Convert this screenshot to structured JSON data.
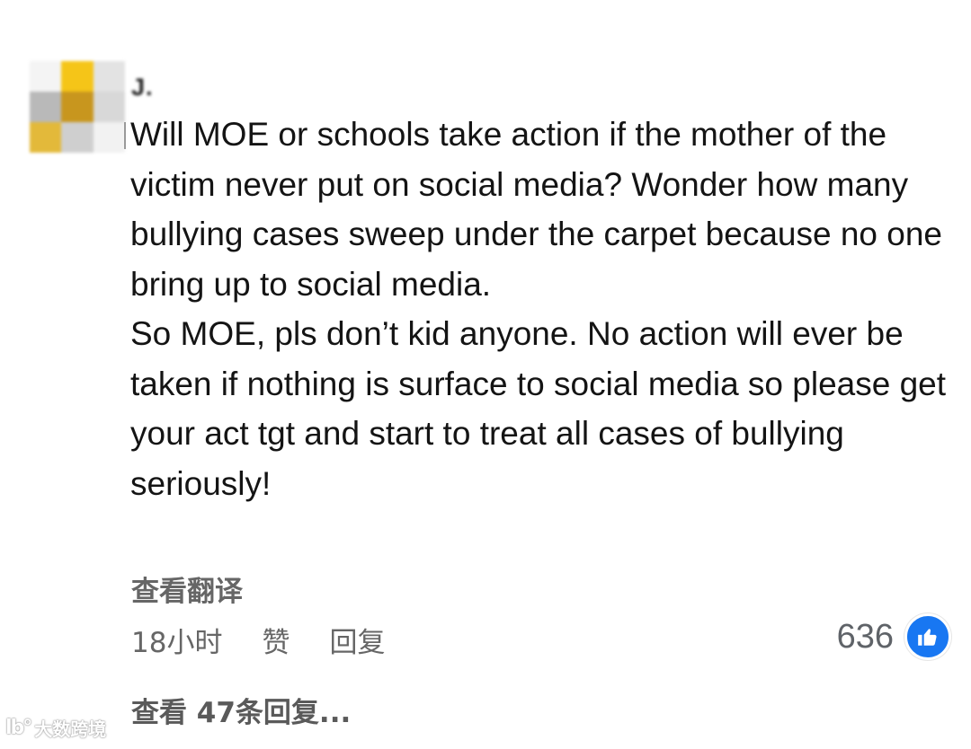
{
  "comment": {
    "author_name": "J.",
    "body_paragraphs": [
      "Will MOE or schools take action if the mother of the victim never put on social media? Wonder how many bullying cases sweep under the carpet because no one bring up to social media.",
      "So MOE, pls don’t kid anyone. No action will ever be taken if nothing is surface to social media so please get your act tgt and start to treat all cases of bullying seriously!"
    ],
    "translate_label": "查看翻译",
    "time_label": "18小时",
    "like_label": "赞",
    "reply_label": "回复",
    "reaction_count": "636",
    "reaction_icon": "thumbs-up-icon",
    "view_replies_label": "查看 47条回复..."
  },
  "watermark": {
    "logo_text": "lb°",
    "text": "大数跨境"
  },
  "colors": {
    "text": "#141414",
    "meta": "#666666",
    "like_badge": "#1877f2"
  }
}
